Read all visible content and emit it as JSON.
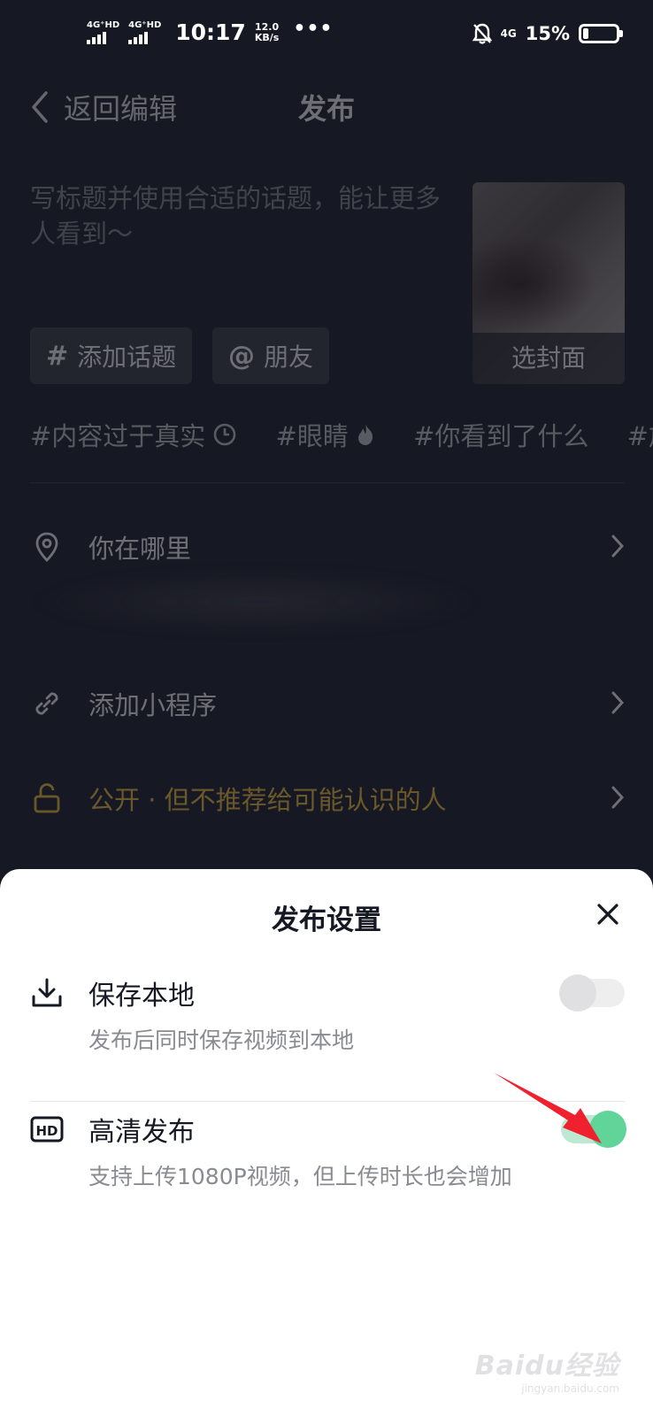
{
  "status_bar": {
    "net1": "4G⁺HD",
    "net2": "4G⁺HD",
    "time": "10:17",
    "speed_value": "12.0",
    "speed_unit": "KB/s",
    "dots": "•••",
    "net_right": "4G",
    "battery": "15%",
    "battery_level": 0.15
  },
  "header": {
    "back_label": "返回编辑",
    "title": "发布"
  },
  "caption": {
    "placeholder": "写标题并使用合适的话题，能让更多人看到～"
  },
  "cover": {
    "label": "选封面"
  },
  "chips": [
    {
      "symbol": "#",
      "label": "添加话题"
    },
    {
      "symbol": "@",
      "label": "朋友"
    }
  ],
  "hashtags": [
    {
      "text": "#内容过于真实",
      "icon": "clock-icon"
    },
    {
      "text": "#眼睛",
      "icon": "fire-icon"
    },
    {
      "text": "#你看到了什么",
      "icon": ""
    },
    {
      "text": "#旅",
      "icon": ""
    }
  ],
  "rows": {
    "location": "你在哪里",
    "mini_program": "添加小程序",
    "privacy": "公开 · 但不推荐给可能认识的人"
  },
  "sheet": {
    "title": "发布设置",
    "save_local": {
      "title": "保存本地",
      "desc": "发布后同时保存视频到本地",
      "enabled": false
    },
    "hd_publish": {
      "title": "高清发布",
      "desc": "支持上传1080P视频，但上传时长也会增加",
      "enabled": true
    }
  },
  "colors": {
    "accent_gold": "#f6c33b",
    "toggle_on": "#61d49a",
    "annotation_arrow": "#f0212f"
  },
  "watermark": {
    "brand": "Baidu经验",
    "url": "jingyan.baidu.com"
  }
}
